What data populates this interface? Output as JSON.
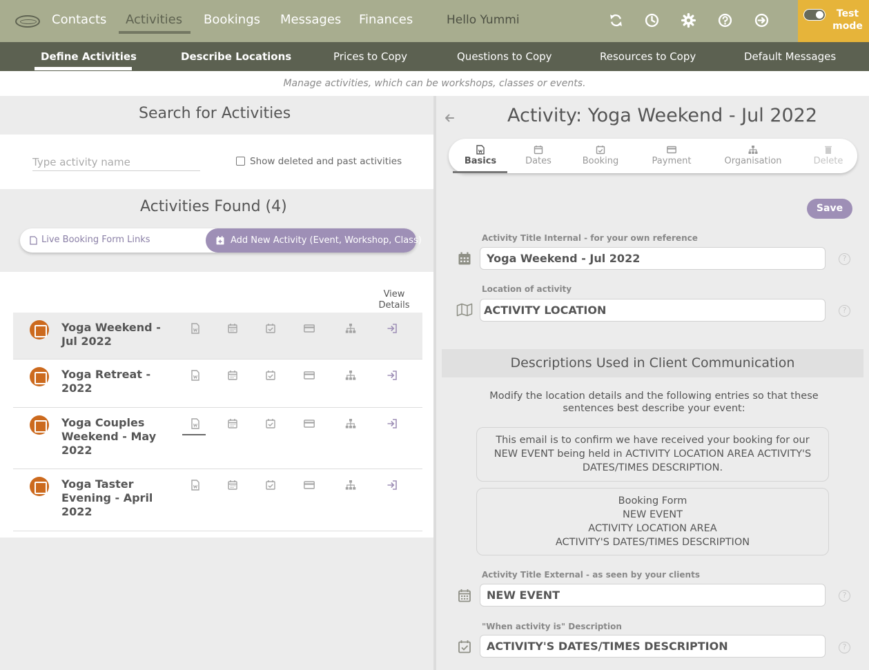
{
  "topbar": {
    "nav": [
      "Contacts",
      "Activities",
      "Bookings",
      "Messages",
      "Finances"
    ],
    "active_nav": "Activities",
    "greeting": "Hello Yummi",
    "icons": [
      "refresh-icon",
      "history-icon",
      "settings-icon",
      "help-icon",
      "logout-icon"
    ],
    "test_mode_label": "Test mode",
    "test_mode_on": true
  },
  "subnav": {
    "tabs": [
      "Define Activities",
      "Describe Locations",
      "Prices to Copy",
      "Questions to Copy",
      "Resources to Copy",
      "Default Messages"
    ],
    "active": "Define Activities"
  },
  "tagline": "Manage activities, which can be workshops, classes or events.",
  "search": {
    "title": "Search for Activities",
    "placeholder": "Type activity name",
    "show_deleted_label": "Show deleted and past activities",
    "show_deleted_checked": false
  },
  "results": {
    "title": "Activities Found (4)",
    "live_links_label": "Live Booking Form Links",
    "add_new_label": "Add New Activity (Event, Workshop, Class)",
    "view_details_header": "View Details",
    "rows": [
      {
        "title": "Yoga Weekend - Jul 2022",
        "selected": true
      },
      {
        "title": "Yoga Retreat - 2022",
        "selected": false
      },
      {
        "title": "Yoga Couples Weekend - May 2022",
        "selected": false
      },
      {
        "title": "Yoga Taster Evening - April 2022",
        "selected": false
      }
    ]
  },
  "activity": {
    "title": "Activity: Yoga Weekend - Jul 2022",
    "tabs": [
      "Basics",
      "Dates",
      "Booking",
      "Payment",
      "Organisation",
      "Delete"
    ],
    "active_tab": "Basics",
    "save_label": "Save",
    "fields": {
      "title_internal_label": "Activity Title Internal - for your own reference",
      "title_internal_value": "Yoga Weekend - Jul 2022",
      "location_label": "Location of activity",
      "location_value": "ACTIVITY LOCATION",
      "title_external_label": "Activity Title External - as seen by your clients",
      "title_external_value": "NEW EVENT",
      "when_label": "\"When activity is\" Description",
      "when_value": "ACTIVITY'S DATES/TIMES DESCRIPTION"
    },
    "descriptions": {
      "header": "Descriptions Used in Client Communication",
      "intro": "Modify the location details and the following entries so that these sentences best describe your event:",
      "email_sentence": "This email is to confirm we have received your booking for our NEW EVENT being held in ACTIVITY LOCATION AREA ACTIVITY'S DATES/TIMES DESCRIPTION.",
      "booking_form_lines": [
        "Booking Form",
        "NEW EVENT",
        "ACTIVITY LOCATION AREA",
        "ACTIVITY'S DATES/TIMES DESCRIPTION"
      ]
    }
  },
  "colors": {
    "topbar": "#a8ad8f",
    "subbar": "#5c6151",
    "test_mode": "#e6b43a",
    "accent_purple": "#9e8fb6",
    "activity_icon": "#cc6a1e"
  }
}
